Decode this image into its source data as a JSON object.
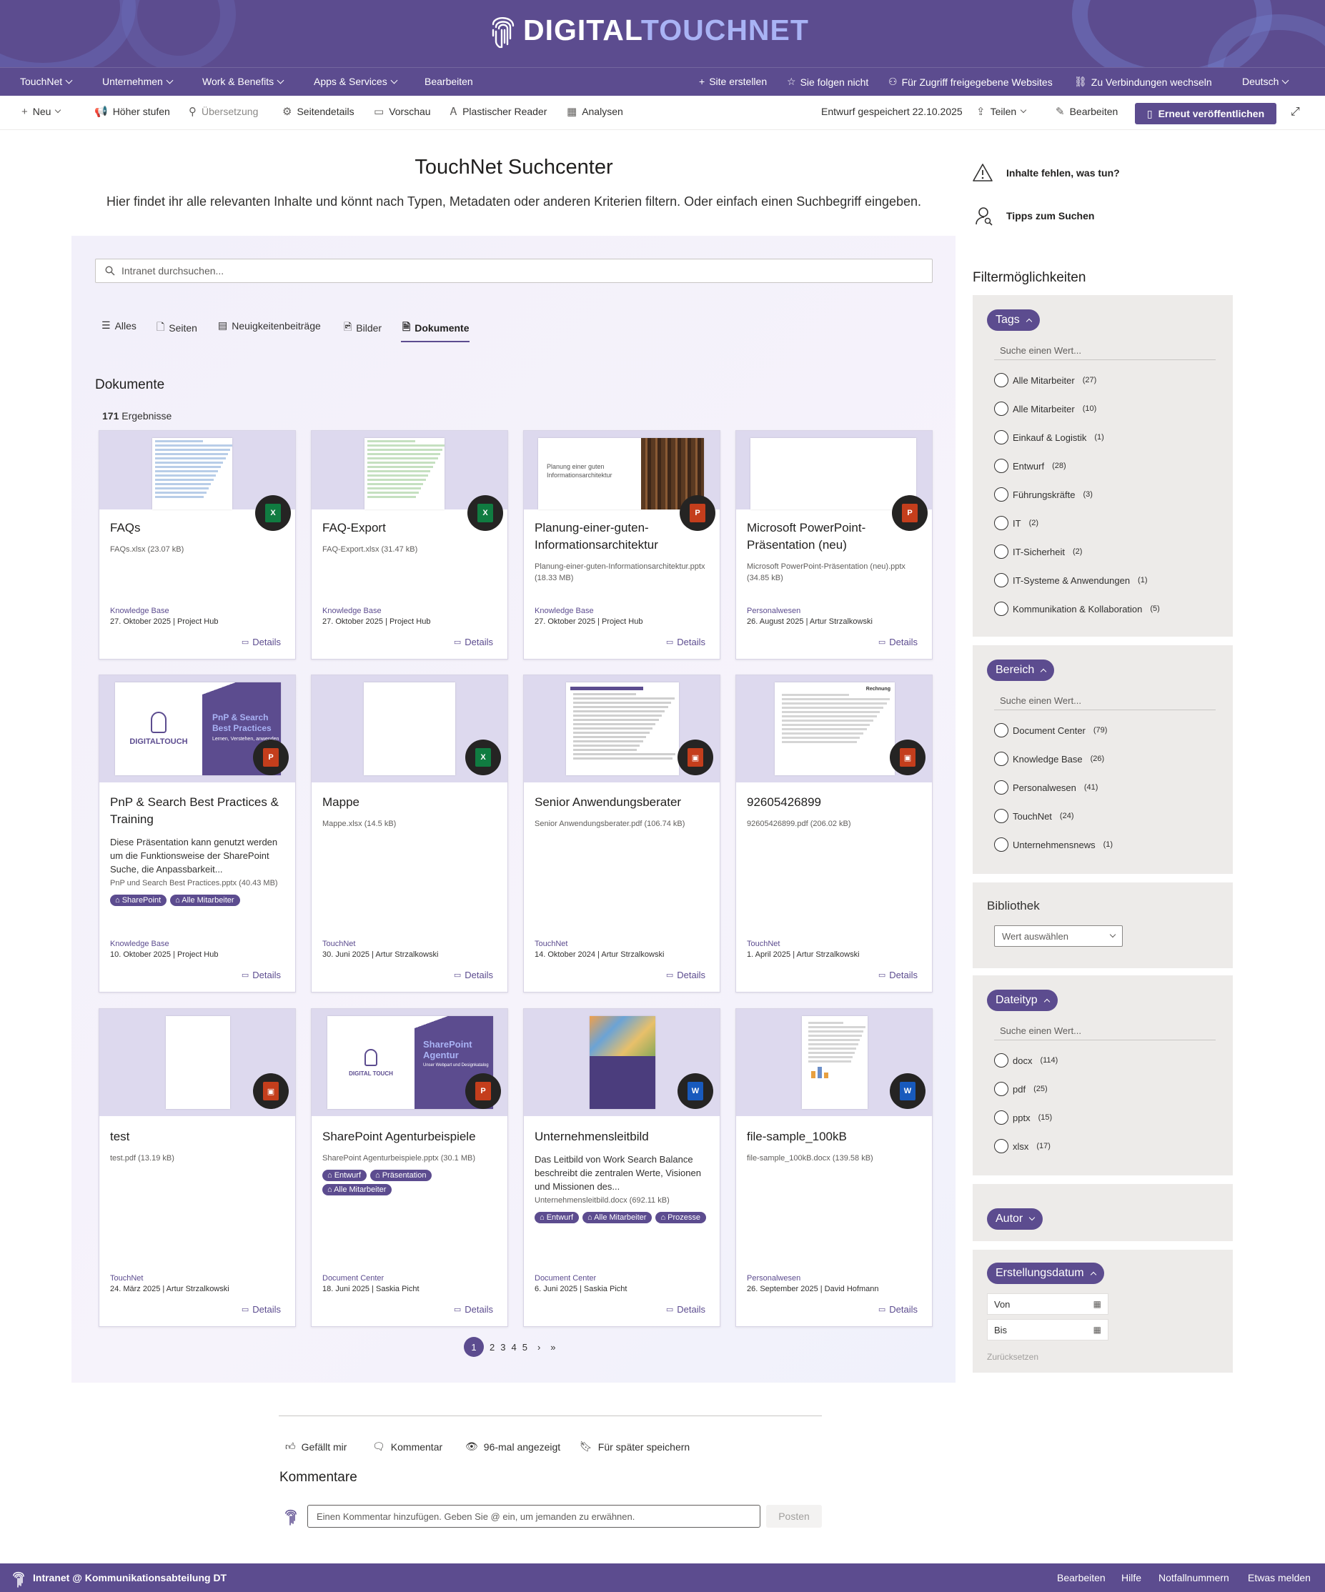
{
  "brand": {
    "logo_part1": "DIGITAL",
    "logo_part2": "TOUCHNET",
    "accent": "#5c4c8f"
  },
  "topnav": {
    "items": [
      "TouchNet",
      "Unternehmen",
      "Work & Benefits",
      "Apps & Services",
      "Bearbeiten"
    ],
    "right": [
      "Site erstellen",
      "Sie folgen nicht",
      "Für Zugriff freigegebene Websites",
      "Zu Verbindungen wechseln",
      "Deutsch"
    ]
  },
  "cmdbar": {
    "new": "Neu",
    "promote": "Höher stufen",
    "translation": "Übersetzung",
    "page_details": "Seitendetails",
    "preview": "Vorschau",
    "immersive_reader": "Plastischer Reader",
    "analytics": "Analysen",
    "draft_status": "Entwurf gespeichert 22.10.2025",
    "share": "Teilen",
    "edit": "Bearbeiten",
    "republish": "Erneut veröffentlichen"
  },
  "page": {
    "title": "TouchNet Suchcenter",
    "subtitle": "Hier findet ihr alle relevanten Inhalte und könnt nach Typen, Metadaten oder anderen Kriterien filtern. Oder einfach einen Suchbegriff eingeben."
  },
  "help_links": [
    "Inhalte fehlen, was tun?",
    "Tipps zum Suchen"
  ],
  "search": {
    "placeholder": "Intranet durchsuchen..."
  },
  "tabs": [
    "Alles",
    "Seiten",
    "Neuigkeitenbeiträge",
    "Bilder",
    "Dokumente"
  ],
  "results": {
    "section_title": "Dokumente",
    "count": "171",
    "count_label": "Ergebnisse",
    "details_label": "Details"
  },
  "cards": [
    {
      "title": "FAQs",
      "file": "FAQs.xlsx (23.07 kB)",
      "desc": "",
      "tags": [],
      "library": "Knowledge Base",
      "meta": "27. Oktober 2025 | Project Hub",
      "filetype": "xlsx"
    },
    {
      "title": "FAQ-Export",
      "file": "FAQ-Export.xlsx (31.47 kB)",
      "desc": "",
      "tags": [],
      "library": "Knowledge Base",
      "meta": "27. Oktober 2025 | Project Hub",
      "filetype": "xlsx"
    },
    {
      "title": "Planung-einer-guten-Informationsarchitektur",
      "file": "Planung-einer-guten-Informationsarchitektur.pptx (18.33 MB)",
      "desc": "",
      "tags": [],
      "library": "Knowledge Base",
      "meta": "27. Oktober 2025 | Project Hub",
      "filetype": "pptx",
      "thumb_title": "Planung einer guten Informationsarchitektur"
    },
    {
      "title": "Microsoft PowerPoint-Präsentation (neu)",
      "file": "Microsoft PowerPoint-Präsentation (neu).pptx (34.85 kB)",
      "desc": "",
      "tags": [],
      "library": "Personalwesen",
      "meta": "26. August 2025 | Artur Strzalkowski",
      "filetype": "pptx"
    },
    {
      "title": "PnP & Search Best Practices & Training",
      "file": "PnP und Search Best Practices.pptx (40.43 MB)",
      "desc": "Diese Präsentation kann genutzt werden um die Funktionsweise der SharePoint Suche, die Anpassbarkeit...",
      "tags": [
        "SharePoint",
        "Alle Mitarbeiter"
      ],
      "library": "Knowledge Base",
      "meta": "10. Oktober 2025 | Project Hub",
      "filetype": "pptx",
      "thumb_title": "PnP & Search Best Practices",
      "thumb_sub": "Lernen, Verstehen, anwenden",
      "thumb_logo": "DIGITALTOUCH"
    },
    {
      "title": "Mappe",
      "file": "Mappe.xlsx (14.5 kB)",
      "desc": "",
      "tags": [],
      "library": "TouchNet",
      "meta": "30. Juni 2025 | Artur Strzalkowski",
      "filetype": "xlsx"
    },
    {
      "title": "Senior Anwendungsberater",
      "file": "Senior Anwendungsberater.pdf (106.74 kB)",
      "desc": "",
      "tags": [],
      "library": "TouchNet",
      "meta": "14. Oktober 2024 | Artur Strzalkowski",
      "filetype": "pdf"
    },
    {
      "title": "92605426899",
      "file": "92605426899.pdf (206.02 kB)",
      "desc": "",
      "tags": [],
      "library": "TouchNet",
      "meta": "1. April 2025 | Artur Strzalkowski",
      "filetype": "pdf",
      "thumb_title": "Rechnung"
    },
    {
      "title": "test",
      "file": "test.pdf (13.19 kB)",
      "desc": "",
      "tags": [],
      "library": "TouchNet",
      "meta": "24. März 2025 | Artur Strzalkowski",
      "filetype": "pdf"
    },
    {
      "title": "SharePoint Agenturbeispiele",
      "file": "SharePoint Agenturbeispiele.pptx (30.1 MB)",
      "desc": "",
      "tags": [
        "Entwurf",
        "Präsentation",
        "Alle Mitarbeiter"
      ],
      "library": "Document Center",
      "meta": "18. Juni 2025 | Saskia Picht",
      "filetype": "pptx",
      "thumb_title": "SharePoint Agentur",
      "thumb_sub": "Unser Webpart und Designkatalog",
      "thumb_logo": "DIGITAL TOUCH"
    },
    {
      "title": "Unternehmensleitbild",
      "file": "Unternehmensleitbild.docx (692.11 kB)",
      "desc": "Das Leitbild von Work Search Balance beschreibt die zentralen Werte, Visionen und Missionen des...",
      "tags": [
        "Entwurf",
        "Alle Mitarbeiter",
        "Prozesse"
      ],
      "library": "Document Center",
      "meta": "6. Juni 2025 | Saskia Picht",
      "filetype": "docx"
    },
    {
      "title": "file-sample_100kB",
      "file": "file-sample_100kB.docx (139.58 kB)",
      "desc": "",
      "tags": [],
      "library": "Personalwesen",
      "meta": "26. September 2025 | David Hofmann",
      "filetype": "docx"
    }
  ],
  "pagination": {
    "current": "1",
    "pages": [
      "2",
      "3",
      "4",
      "5"
    ],
    "next": "›",
    "last": "»"
  },
  "filters": {
    "title": "Filtermöglichkeiten",
    "search_placeholder": "Suche einen Wert...",
    "tags": {
      "label": "Tags",
      "options": [
        {
          "name": "Alle Mitarbeiter",
          "count": "(27)"
        },
        {
          "name": "Alle Mitarbeiter",
          "count": "(10)"
        },
        {
          "name": "Einkauf & Logistik",
          "count": "(1)"
        },
        {
          "name": "Entwurf",
          "count": "(28)"
        },
        {
          "name": "Führungskräfte",
          "count": "(3)"
        },
        {
          "name": "IT",
          "count": "(2)"
        },
        {
          "name": "IT-Sicherheit",
          "count": "(2)"
        },
        {
          "name": "IT-Systeme & Anwendungen",
          "count": "(1)"
        },
        {
          "name": "Kommunikation & Kollaboration",
          "count": "(5)"
        }
      ]
    },
    "bereich": {
      "label": "Bereich",
      "options": [
        {
          "name": "Document Center",
          "count": "(79)"
        },
        {
          "name": "Knowledge Base",
          "count": "(26)"
        },
        {
          "name": "Personalwesen",
          "count": "(41)"
        },
        {
          "name": "TouchNet",
          "count": "(24)"
        },
        {
          "name": "Unternehmensnews",
          "count": "(1)"
        }
      ]
    },
    "bibliothek": {
      "label": "Bibliothek",
      "placeholder": "Wert auswählen"
    },
    "dateityp": {
      "label": "Dateityp",
      "options": [
        {
          "name": "docx",
          "count": "(114)"
        },
        {
          "name": "pdf",
          "count": "(25)"
        },
        {
          "name": "pptx",
          "count": "(15)"
        },
        {
          "name": "xlsx",
          "count": "(17)"
        }
      ]
    },
    "autor": {
      "label": "Autor"
    },
    "erstellungsdatum": {
      "label": "Erstellungsdatum",
      "from": "Von",
      "to": "Bis",
      "reset": "Zurücksetzen"
    }
  },
  "footer_actions": {
    "like": "Gefällt mir",
    "comment": "Kommentar",
    "views": "96-mal angezeigt",
    "save": "Für später speichern"
  },
  "comments": {
    "title": "Kommentare",
    "placeholder": "Einen Kommentar hinzufügen. Geben Sie @ ein, um jemanden zu erwähnen.",
    "post": "Posten"
  },
  "bottombar": {
    "site": "Intranet @ Kommunikationsabteilung DT",
    "links": [
      "Bearbeiten",
      "Hilfe",
      "Notfallnummern",
      "Etwas melden"
    ]
  },
  "filetype_colors": {
    "xlsx": "#107c41",
    "pptx": "#c43e1c",
    "pdf": "#c43e1c",
    "docx": "#185abd"
  }
}
